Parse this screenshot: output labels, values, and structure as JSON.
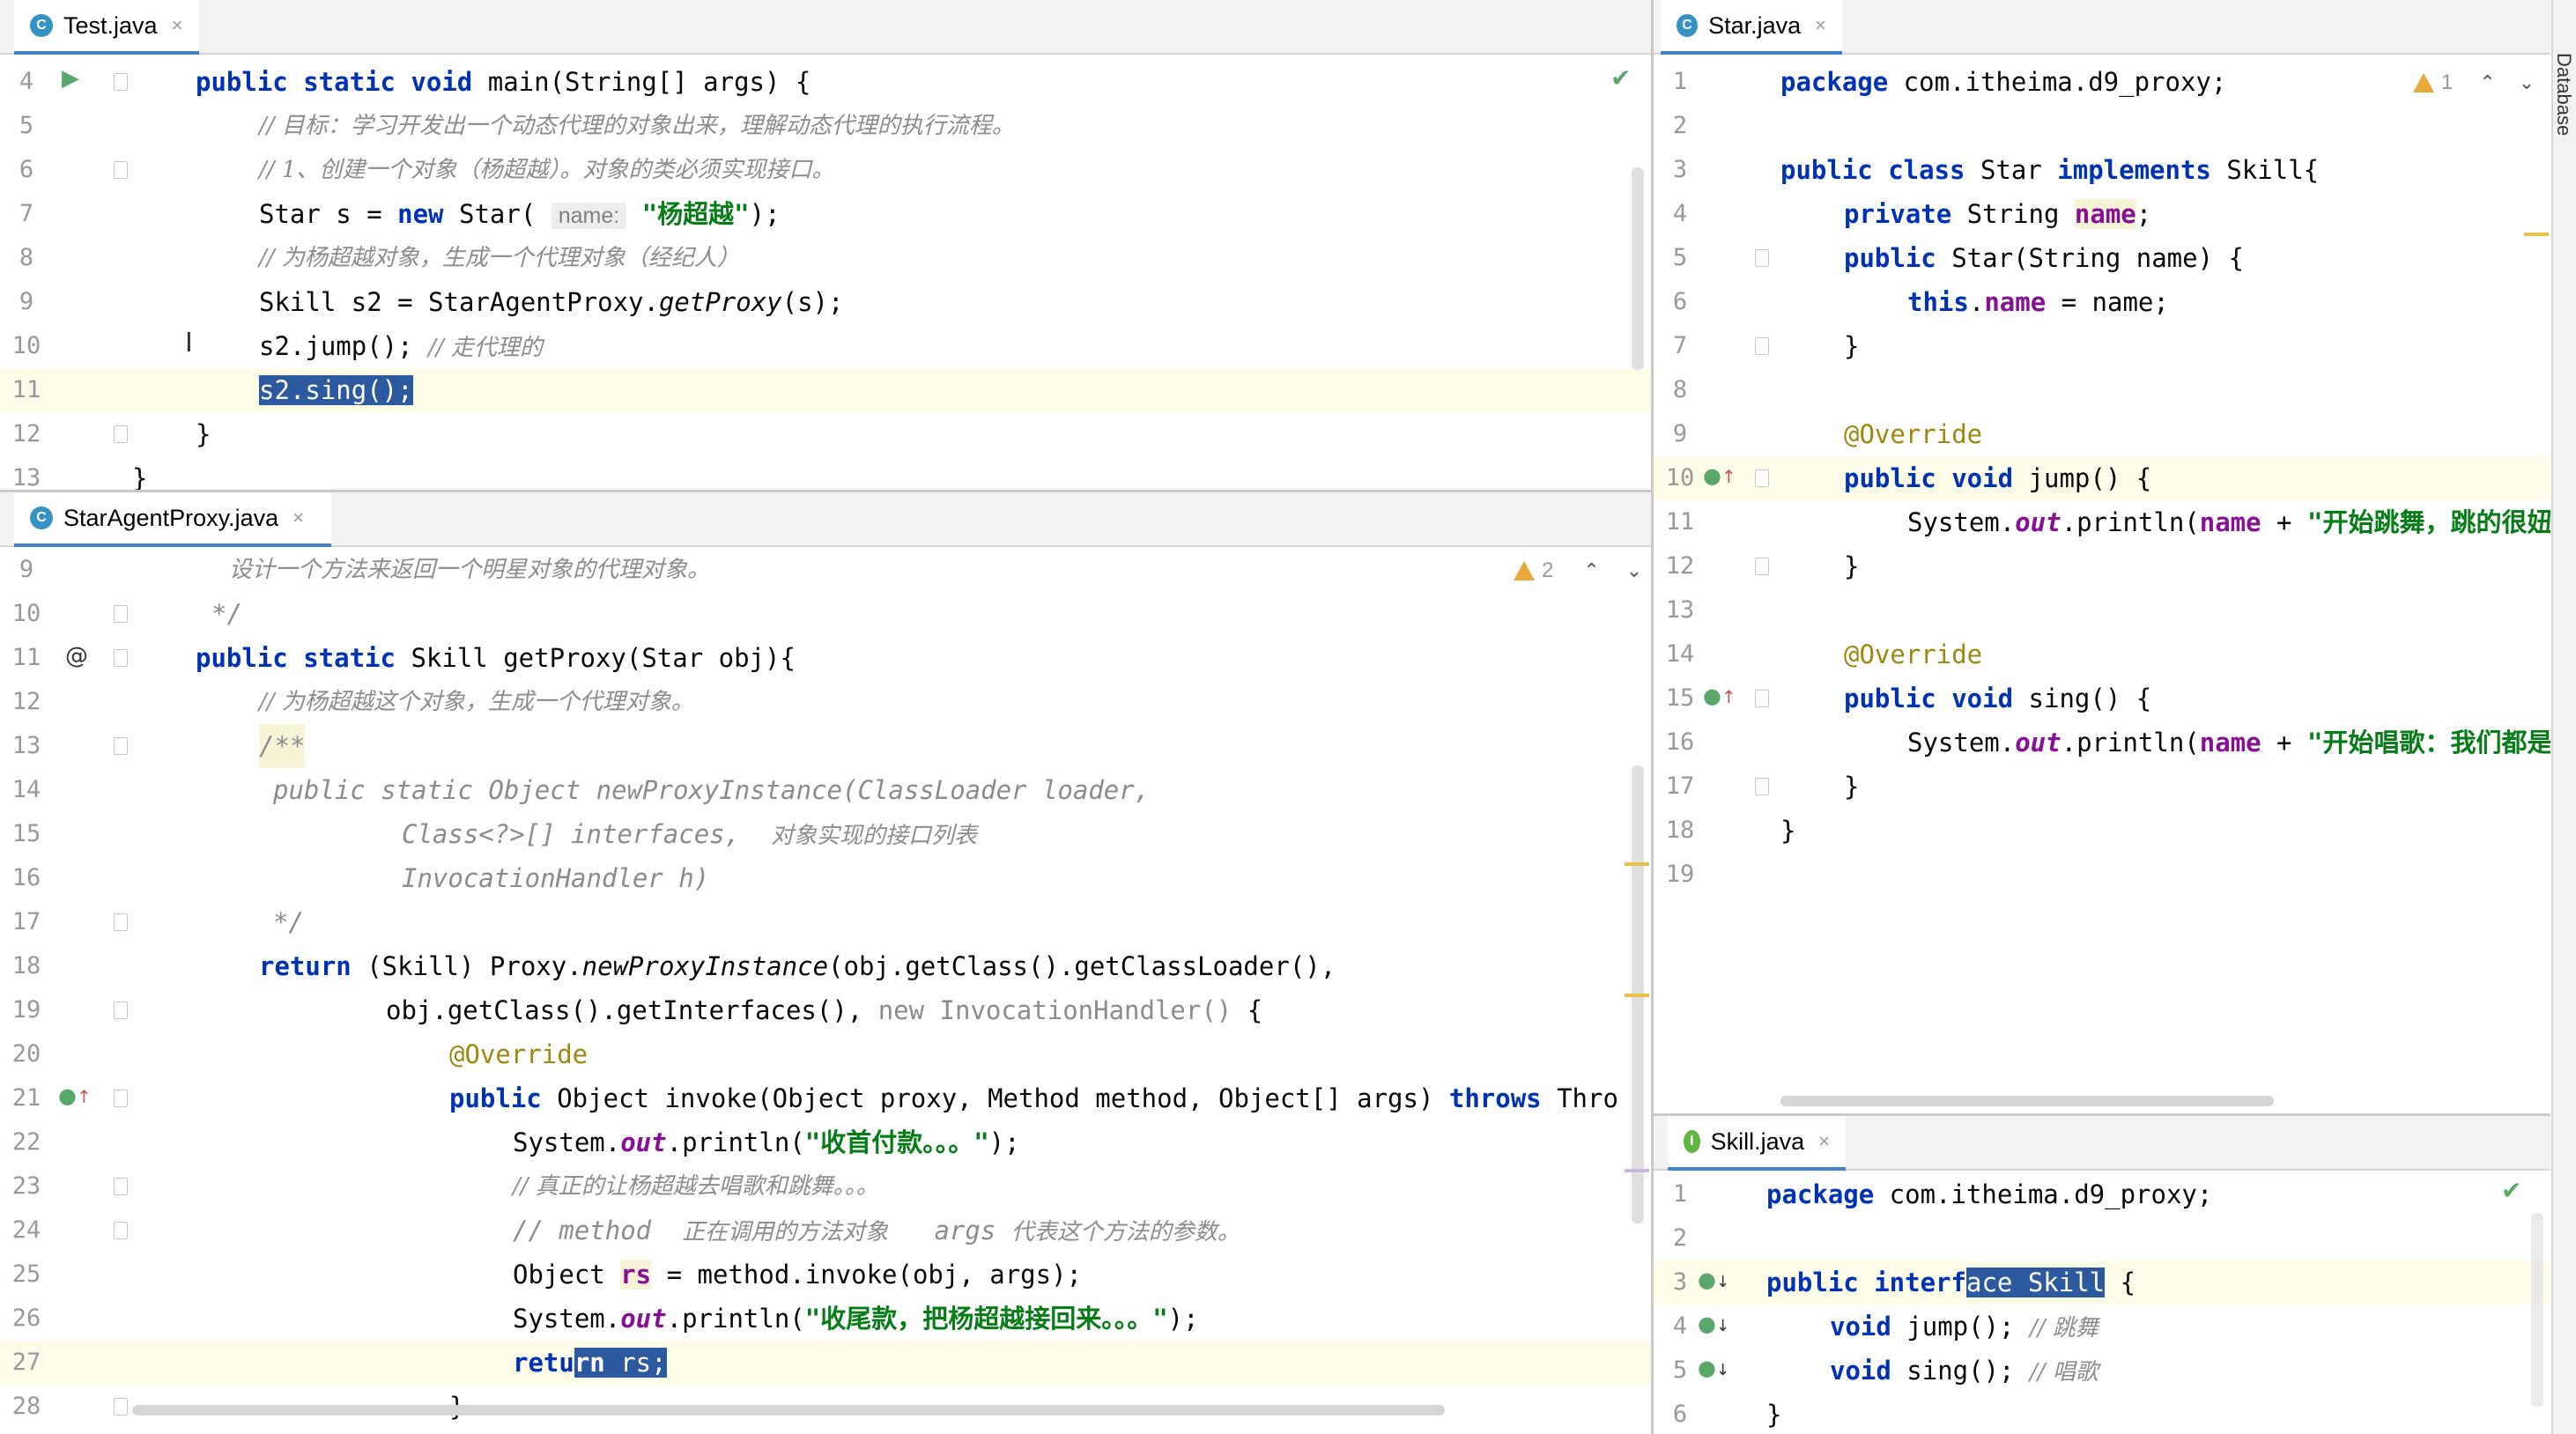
{
  "tabs": {
    "test": {
      "title": "Test.java",
      "close": "×",
      "icon": "C"
    },
    "proxy": {
      "title": "StarAgentProxy.java",
      "close": "×",
      "icon": "C"
    },
    "star": {
      "title": "Star.java",
      "close": "×",
      "icon": "C"
    },
    "skill": {
      "title": "Skill.java",
      "close": "×",
      "icon": "I"
    }
  },
  "side_tool": {
    "label": "Database"
  },
  "test_editor": {
    "line_numbers": [
      "4",
      "5",
      "6",
      "7",
      "8",
      "9",
      "10",
      "11",
      "12",
      "13"
    ],
    "l4": {
      "kw": "public static void",
      "text": " main(String[] args) {"
    },
    "l5": {
      "comment": "// 目标：学习开发出一个动态代理的对象出来，理解动态代理的执行流程。"
    },
    "l6": {
      "comment": "// 1、创建一个对象（杨超越）。对象的类必须实现接口。"
    },
    "l7": {
      "pre": "Star s = ",
      "kw": "new",
      "mid": " Star( ",
      "hint": "name:",
      "str": "\"杨超越\"",
      "post": ");"
    },
    "l8": {
      "comment": "// 为杨超越对象，生成一个代理对象（经纪人）"
    },
    "l9": {
      "pre": "Skill s2 = StarAgentProxy.",
      "method": "getProxy",
      "post": "(s);"
    },
    "l10": {
      "code": "s2.jump(); ",
      "comment": "// 走代理的"
    },
    "l11": {
      "code": "s2.sing();"
    },
    "l12": {
      "code": "}"
    },
    "l13": {
      "code": "}"
    }
  },
  "proxy_editor": {
    "warnings": "2",
    "line_numbers": [
      "9",
      "10",
      "11",
      "12",
      "13",
      "14",
      "15",
      "16",
      "17",
      "18",
      "19",
      "20",
      "21",
      "22",
      "23",
      "24",
      "25",
      "26",
      "27",
      "28"
    ],
    "l9": {
      "comment": "设计一个方法来返回一个明星对象的代理对象。"
    },
    "l10": {
      "comment": "*/"
    },
    "l11": {
      "kw": "public static",
      "text": " Skill getProxy(Star obj){",
      "gutter": "@"
    },
    "l12": {
      "comment": "// 为杨超越这个对象，生成一个代理对象。"
    },
    "l13": {
      "comment": "/**"
    },
    "l14": {
      "comment": "public static Object newProxyInstance(ClassLoader loader,"
    },
    "l15": {
      "comment": "Class<?>[] interfaces,",
      "zh": "对象实现的接口列表"
    },
    "l16": {
      "comment": "InvocationHandler h)"
    },
    "l17": {
      "comment": "*/"
    },
    "l18": {
      "kw": "return",
      "pre": " (Skill) Proxy.",
      "method": "newProxyInstance",
      "post": "(obj.getClass().getClassLoader(),"
    },
    "l19": {
      "pre": "obj.getClass().getInterfaces(), ",
      "gray": "new InvocationHandler()",
      "post": " {"
    },
    "l20": {
      "annotation": "@Override"
    },
    "l21": {
      "kw": "public",
      "text": " Object invoke(Object proxy, Method method, Object[] args) ",
      "kw2": "throws",
      "post": " Thro"
    },
    "l22": {
      "pre": "System.",
      "field": "out",
      "mid": ".println(",
      "str": "\"收首付款。。。\"",
      "post": ");"
    },
    "l23": {
      "comment": "// 真正的让杨超越去唱歌和跳舞。。。"
    },
    "l24": {
      "comment": "// method",
      "zh1": "正在调用的方法对象",
      "c2": "args",
      "zh2": "代表这个方法的参数。"
    },
    "l25": {
      "pre": "Object ",
      "var": "rs",
      "post": " = method.invoke(obj, args);"
    },
    "l26": {
      "pre": "System.",
      "field": "out",
      "mid": ".println(",
      "str": "\"收尾款，把杨超越接回来。。。\"",
      "post": ");"
    },
    "l27": {
      "kw_a": "retu",
      "kw_b": "rn",
      "sel": " rs;"
    },
    "l28": {
      "code": "}"
    }
  },
  "star_editor": {
    "warnings": "1",
    "line_numbers": [
      "1",
      "2",
      "3",
      "4",
      "5",
      "6",
      "7",
      "8",
      "9",
      "10",
      "11",
      "12",
      "13",
      "14",
      "15",
      "16",
      "17",
      "18",
      "19"
    ],
    "l1": {
      "kw": "package",
      "text": " com.itheima.d9_proxy;"
    },
    "l3": {
      "kw": "public class",
      "mid": " Star ",
      "kw2": "implements",
      "post": " Skill{"
    },
    "l4": {
      "kw": "private",
      "mid": " String ",
      "field": "name",
      "post": ";"
    },
    "l5": {
      "kw": "public",
      "text": " Star(String name) {"
    },
    "l6": {
      "kw": "this",
      "dot": ".",
      "field": "name",
      "post": " = name;"
    },
    "l7": {
      "code": "}"
    },
    "l9": {
      "annotation": "@Override"
    },
    "l10": {
      "kw": "public void",
      "text": " jump() {"
    },
    "l11": {
      "pre": "System.",
      "field": "out",
      "mid": ".println(",
      "var": "name",
      "plus": " + ",
      "str": "\"开始跳舞，跳的很妞"
    },
    "l12": {
      "code": "}"
    },
    "l14": {
      "annotation": "@Override"
    },
    "l15": {
      "kw": "public void",
      "text": " sing() {"
    },
    "l16": {
      "pre": "System.",
      "field": "out",
      "mid": ".println(",
      "var": "name",
      "plus": " + ",
      "str": "\"开始唱歌：我们都是"
    },
    "l17": {
      "code": "}"
    },
    "l18": {
      "code": "}"
    }
  },
  "skill_editor": {
    "line_numbers": [
      "1",
      "2",
      "3",
      "4",
      "5",
      "6"
    ],
    "l1": {
      "kw": "package",
      "text": " com.itheima.d9_proxy;"
    },
    "l3": {
      "kw": "public interf",
      "sel": "ace Skill",
      "post": " {"
    },
    "l4": {
      "kw": "void",
      "text": " jump(); ",
      "comment": "// 跳舞"
    },
    "l5": {
      "kw": "void",
      "text": " sing(); ",
      "comment": "// 唱歌"
    },
    "l6": {
      "code": "}"
    }
  },
  "colors": {
    "keyword": "#0033b3",
    "string": "#067d17",
    "comment": "#8c8c8c",
    "field": "#871094",
    "annotation": "#9e880d",
    "selection": "#2d5a9e",
    "current_line": "#fdfce8"
  }
}
